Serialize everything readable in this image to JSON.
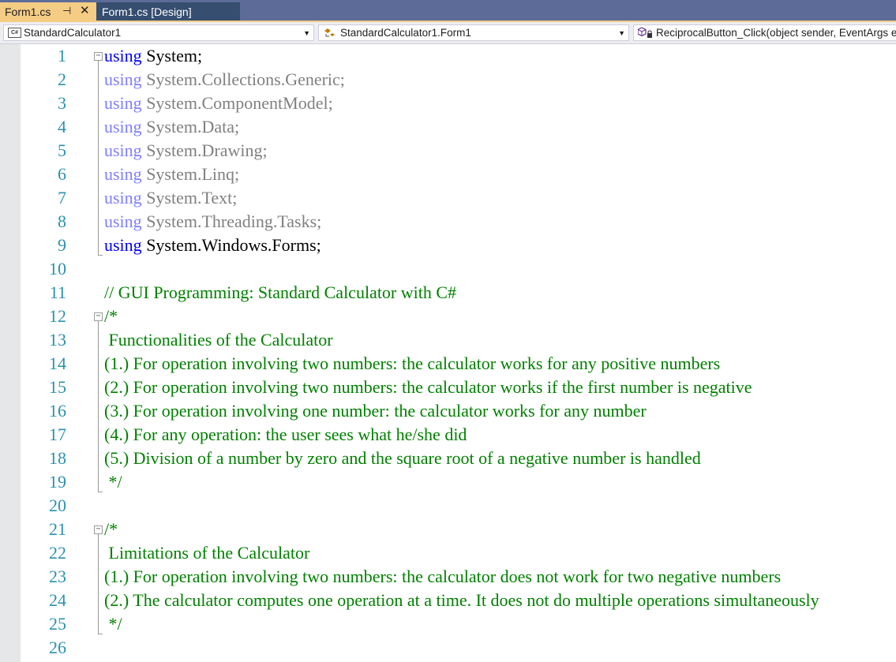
{
  "tabs": {
    "active_label": "Form1.cs",
    "inactive_label": "Form1.cs [Design]"
  },
  "navbar": {
    "project": "StandardCalculator1",
    "class": "StandardCalculator1.Form1",
    "member": "ReciprocalButton_Click(object sender, EventArgs e)"
  },
  "icons": {
    "pin": "pin-icon",
    "close": "close-icon",
    "csharp": "csharp-file-icon",
    "class": "class-icon",
    "method": "method-icon",
    "fold": "collapse-icon"
  },
  "colors": {
    "keyword": "#0000ff",
    "comment": "#008000",
    "line_number": "#2b91af",
    "tab_active": "#f5cc84",
    "tab_bar": "#5d6b99"
  },
  "code": {
    "line_numbers": [
      "1",
      "2",
      "3",
      "4",
      "5",
      "6",
      "7",
      "8",
      "9",
      "10",
      "11",
      "12",
      "13",
      "14",
      "15",
      "16",
      "17",
      "18",
      "19",
      "20",
      "21",
      "22",
      "23",
      "24",
      "25",
      "26"
    ],
    "l1_kw": "using",
    "l1_rest": " System;",
    "l2_kw": "using",
    "l2_rest": " System.Collections.Generic;",
    "l3_kw": "using",
    "l3_rest": " System.ComponentModel;",
    "l4_kw": "using",
    "l4_rest": " System.Data;",
    "l5_kw": "using",
    "l5_rest": " System.Drawing;",
    "l6_kw": "using",
    "l6_rest": " System.Linq;",
    "l7_kw": "using",
    "l7_rest": " System.Text;",
    "l8_kw": "using",
    "l8_rest": " System.Threading.Tasks;",
    "l9_kw": "using",
    "l9_rest": " System.Windows.Forms;",
    "l11": "// GUI Programming: Standard Calculator with C#",
    "l12": "/*",
    "l13": " Functionalities of the Calculator",
    "l14": "(1.) For operation involving two numbers: the calculator works for any positive numbers",
    "l15": "(2.) For operation involving two numbers: the calculator works if the first number is negative",
    "l16": "(3.) For operation involving one number: the calculator works for any number",
    "l17": "(4.) For any operation: the user sees what he/she did",
    "l18": "(5.) Division of a number by zero and the square root of a negative number is handled",
    "l19": " */",
    "l21": "/*",
    "l22": " Limitations of the Calculator",
    "l23": "(1.) For operation involving two numbers: the calculator does not work for two negative numbers",
    "l24": "(2.) The calculator computes one operation at a time. It does not do multiple operations simultaneously",
    "l25": " */"
  }
}
